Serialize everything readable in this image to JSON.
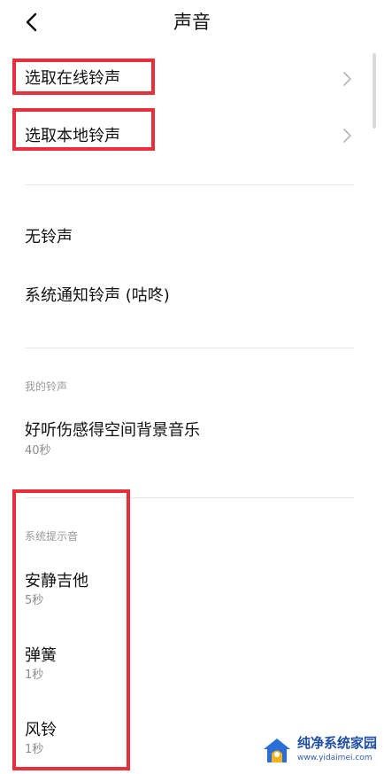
{
  "header": {
    "title": "声音"
  },
  "picker": {
    "online_label": "选取在线铃声",
    "local_label": "选取本地铃声"
  },
  "defaults": {
    "items": [
      {
        "label": "无铃声"
      },
      {
        "label": "系统通知铃声 (咕咚)"
      }
    ]
  },
  "my_ringtones": {
    "header": "我的铃声",
    "items": [
      {
        "label": "好听伤感得空间背景音乐",
        "duration": "40秒"
      }
    ]
  },
  "system_tones": {
    "header": "系统提示音",
    "items": [
      {
        "label": "安静吉他",
        "duration": "5秒"
      },
      {
        "label": "弹簧",
        "duration": "1秒"
      },
      {
        "label": "风铃",
        "duration": "1秒"
      }
    ]
  },
  "watermark": {
    "title": "纯净系统家园",
    "url": "www.yidaimei.com"
  },
  "colors": {
    "highlight": "#e8303a",
    "divider": "#e6e6e6",
    "secondary_text": "#8c8c8c",
    "watermark_blue": "#1f4fa8"
  },
  "icons": {
    "back": "chevron-left-icon",
    "row_arrow": "chevron-right-icon"
  }
}
